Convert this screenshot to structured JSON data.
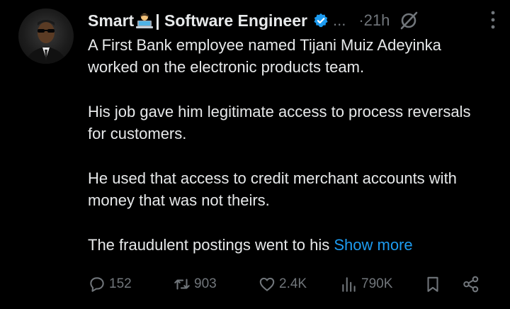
{
  "author": {
    "name": "Smart",
    "name_suffix": "| Software Engineer",
    "ellipsis": "...",
    "time": "·21h"
  },
  "tweet": {
    "paragraphs": [
      "A First Bank employee named Tijani Muiz Adeyinka worked on the electronic products team.",
      "His job gave him legitimate access to process reversals for customers.",
      "He used that access to credit merchant accounts with money that was not theirs."
    ],
    "last_line": "The fraudulent postings went to his",
    "show_more": "Show more"
  },
  "actions": {
    "replies": "152",
    "reposts": "903",
    "likes": "2.4K",
    "views": "790K"
  },
  "colors": {
    "accent": "#1d9bf0",
    "muted": "#71767b",
    "text": "#e7e9ea"
  },
  "icons": [
    "emoji-technologist-icon",
    "verified-badge-icon",
    "grok-icon",
    "more-vertical-icon",
    "reply-icon",
    "repost-icon",
    "like-icon",
    "views-icon",
    "bookmark-icon",
    "share-icon"
  ]
}
